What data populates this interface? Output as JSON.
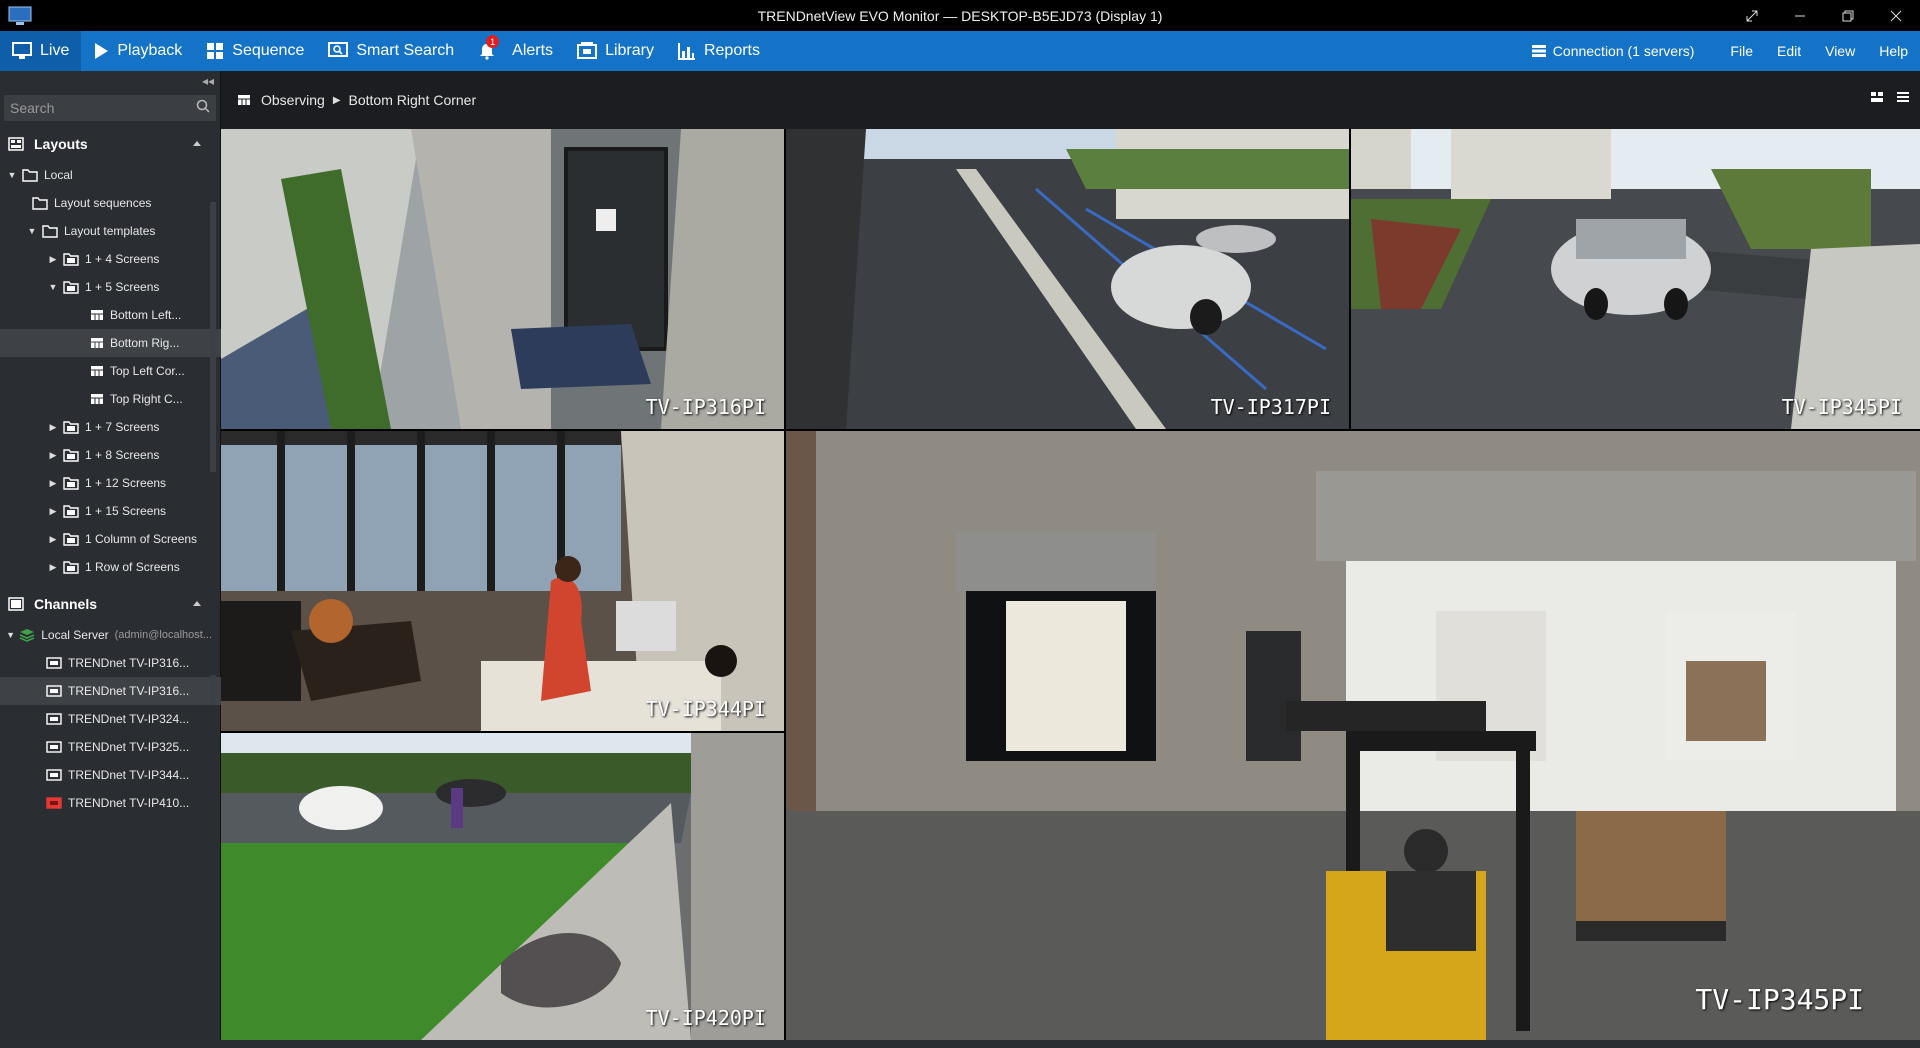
{
  "window": {
    "title": "TRENDnetView EVO Monitor — DESKTOP-B5EJD73 (Display 1)"
  },
  "menubar": {
    "nav": [
      {
        "label": "Live",
        "icon": "monitor-icon"
      },
      {
        "label": "Playback",
        "icon": "play-icon"
      },
      {
        "label": "Sequence",
        "icon": "grid-icon"
      },
      {
        "label": "Smart Search",
        "icon": "smart-search-icon"
      },
      {
        "label": "Alerts",
        "icon": "bell-icon",
        "badge": "1"
      },
      {
        "label": "Library",
        "icon": "library-icon"
      },
      {
        "label": "Reports",
        "icon": "chart-icon"
      }
    ],
    "connection": "Connection (1 servers)",
    "menus": [
      "File",
      "Edit",
      "View",
      "Help"
    ]
  },
  "sidebar": {
    "search_placeholder": "Search",
    "layouts_title": "Layouts",
    "layouts": {
      "local": "Local",
      "sequences": "Layout sequences",
      "templates": "Layout templates",
      "groups": [
        {
          "label": "1 +  4 Screens"
        },
        {
          "label": "1 +  5 Screens",
          "children": [
            "Bottom Left...",
            "Bottom Rig...",
            "Top Left Cor...",
            "Top Right C..."
          ]
        },
        {
          "label": "1 +  7 Screens"
        },
        {
          "label": "1 +  8 Screens"
        },
        {
          "label": "1 + 12 Screens"
        },
        {
          "label": "1 + 15 Screens"
        },
        {
          "label": "1 Column of Screens"
        },
        {
          "label": "1 Row of Screens"
        }
      ]
    },
    "channels_title": "Channels",
    "server": {
      "label": "Local Server",
      "user": "(admin@localhost..."
    },
    "channels": [
      {
        "label": "TRENDnet TV-IP316...",
        "status": "online"
      },
      {
        "label": "TRENDnet TV-IP316...",
        "status": "online"
      },
      {
        "label": "TRENDnet TV-IP324...",
        "status": "online"
      },
      {
        "label": "TRENDnet TV-IP325...",
        "status": "online"
      },
      {
        "label": "TRENDnet TV-IP344...",
        "status": "online"
      },
      {
        "label": "TRENDnet TV-IP410...",
        "status": "offline"
      }
    ]
  },
  "breadcrumb": {
    "root": "Observing",
    "current": "Bottom Right Corner"
  },
  "cameras": {
    "c1": "TV-IP316PI",
    "c2": "TV-IP317PI",
    "c3": "TV-IP345PI",
    "c4": "TV-IP344PI",
    "c5": "TV-IP420PI",
    "c6": "TV-IP345PI"
  },
  "colors": {
    "accent": "#1473c6",
    "offline": "#e53935",
    "server": "#3fa14a"
  }
}
